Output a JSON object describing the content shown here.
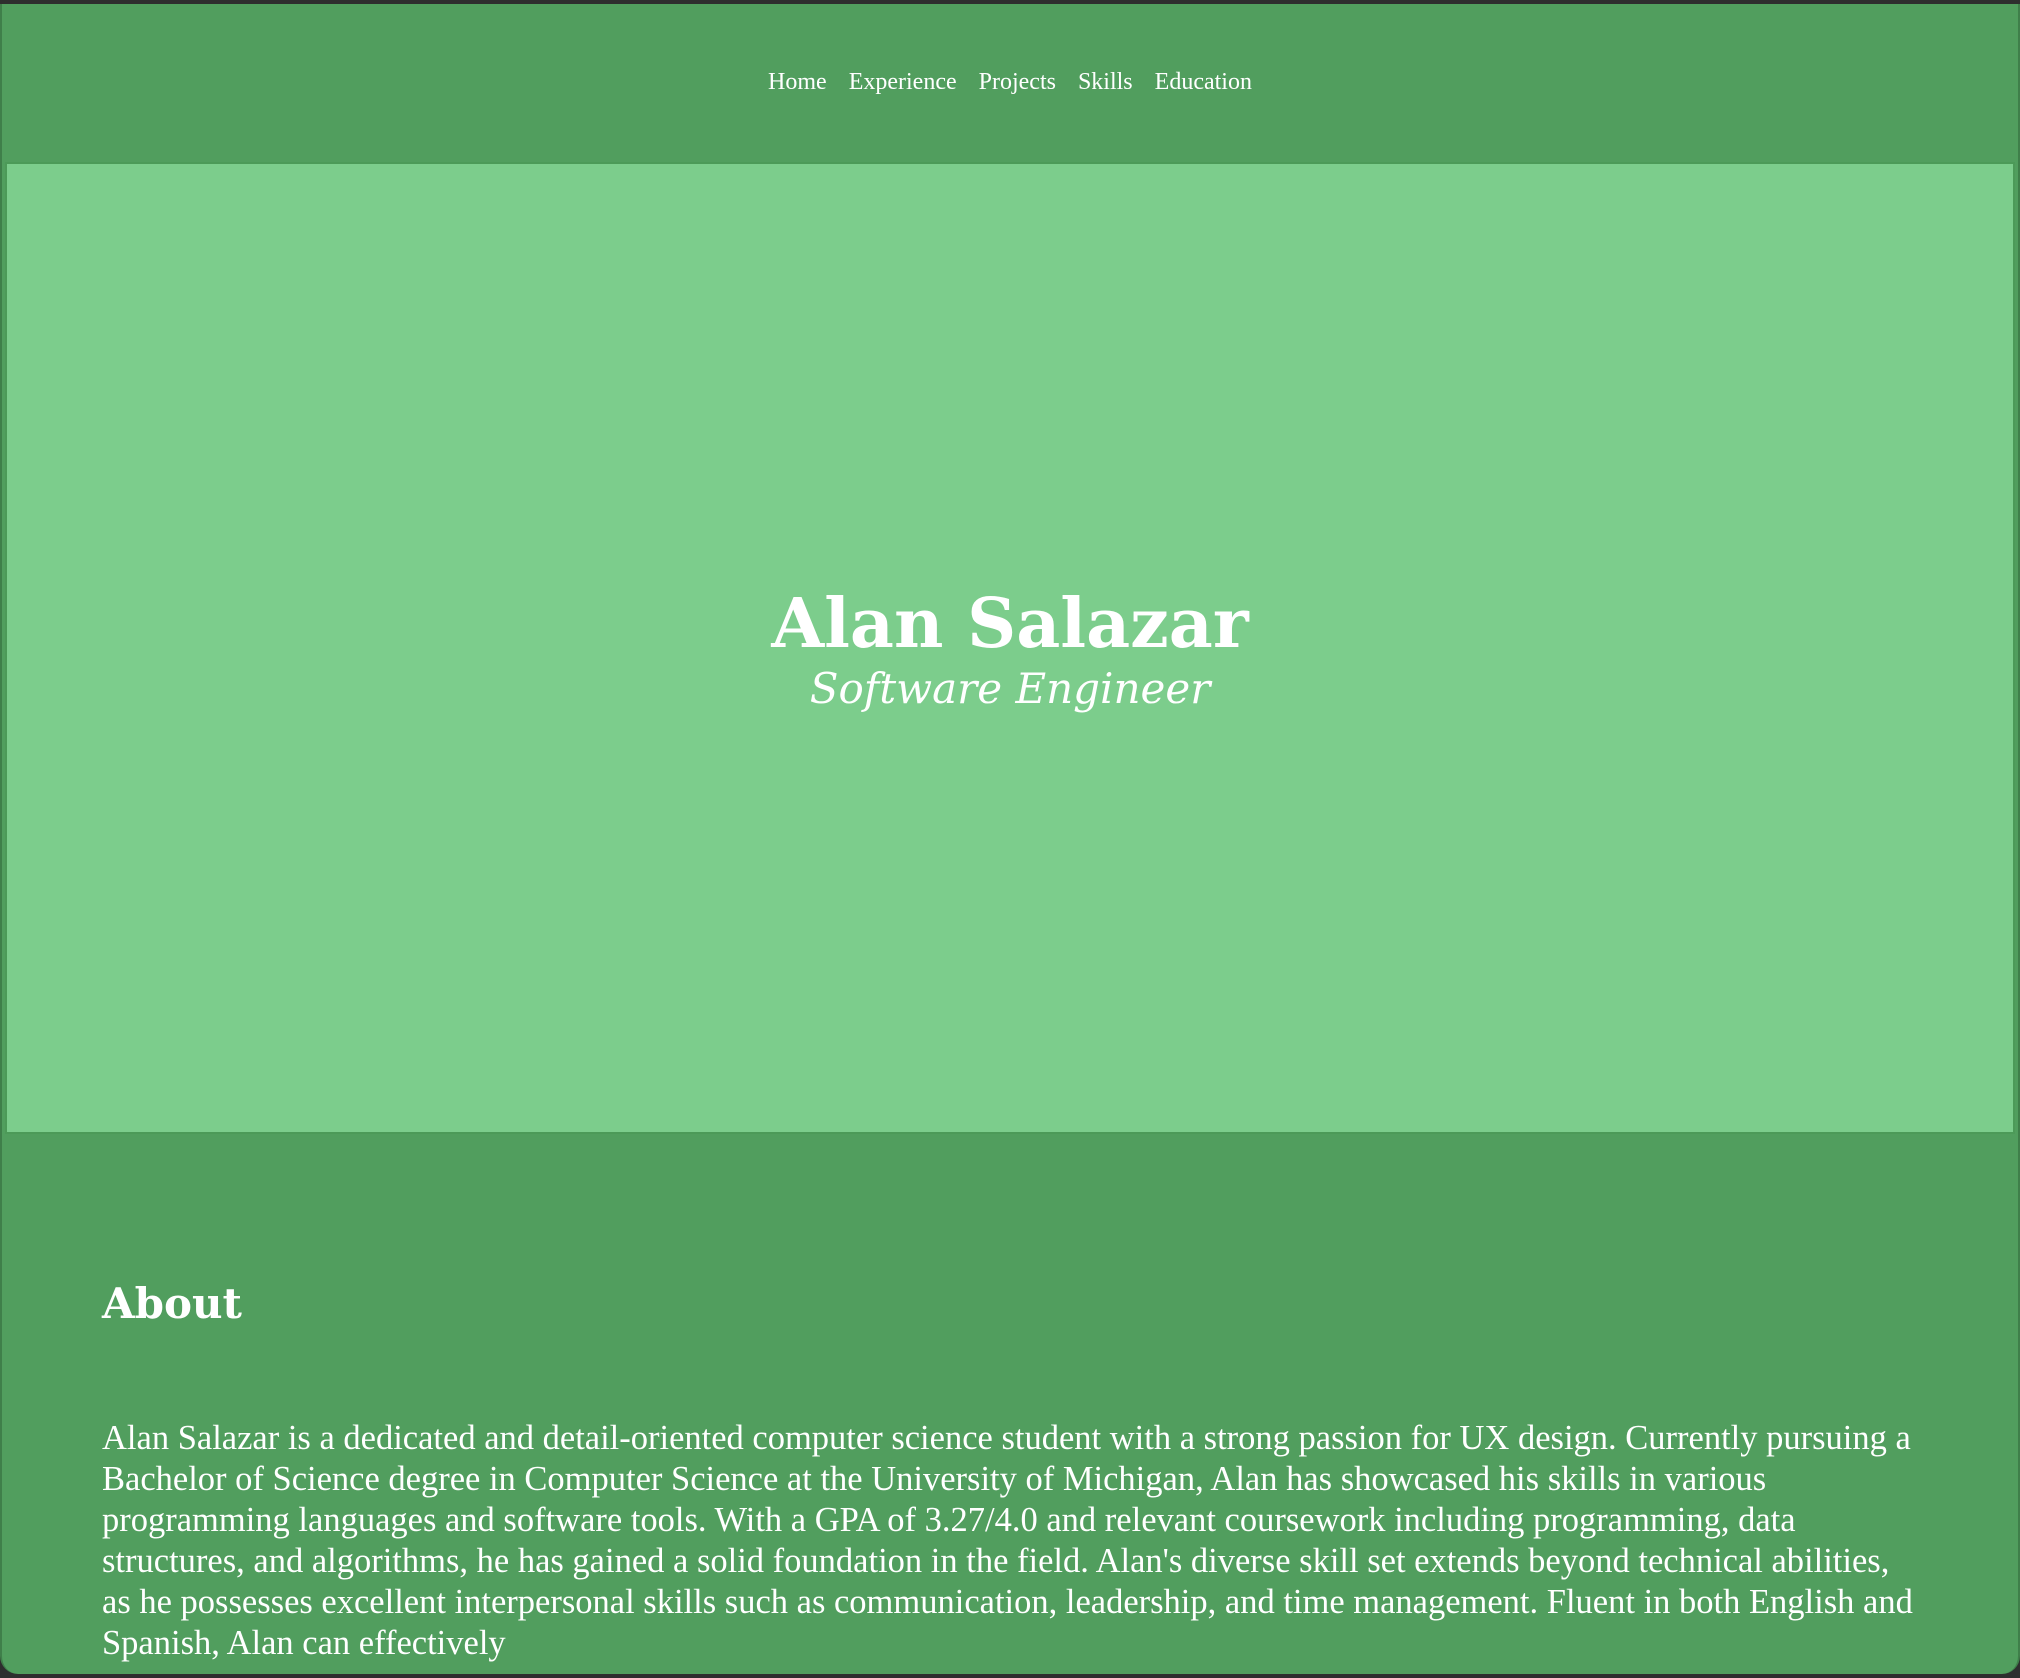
{
  "nav": {
    "items": [
      {
        "label": "Home"
      },
      {
        "label": "Experience"
      },
      {
        "label": "Projects"
      },
      {
        "label": "Skills"
      },
      {
        "label": "Education"
      }
    ]
  },
  "hero": {
    "name": "Alan Salazar",
    "role": "Software Engineer"
  },
  "about": {
    "title": "About",
    "text": "Alan Salazar is a dedicated and detail-oriented computer science student with a strong passion for UX design. Currently pursuing a Bachelor of Science degree in Computer Science at the University of Michigan, Alan has showcased his skills in various programming languages and software tools. With a GPA of 3.27/4.0 and relevant coursework including programming, data structures, and algorithms, he has gained a solid foundation in the field. Alan's diverse skill set extends beyond technical abilities, as he possesses excellent interpersonal skills such as communication, leadership, and time management. Fluent in both English and Spanish, Alan can effectively"
  },
  "colors": {
    "page_background": "#519e5e",
    "hero_background": "#7ccd8c",
    "text": "#ffffff"
  }
}
